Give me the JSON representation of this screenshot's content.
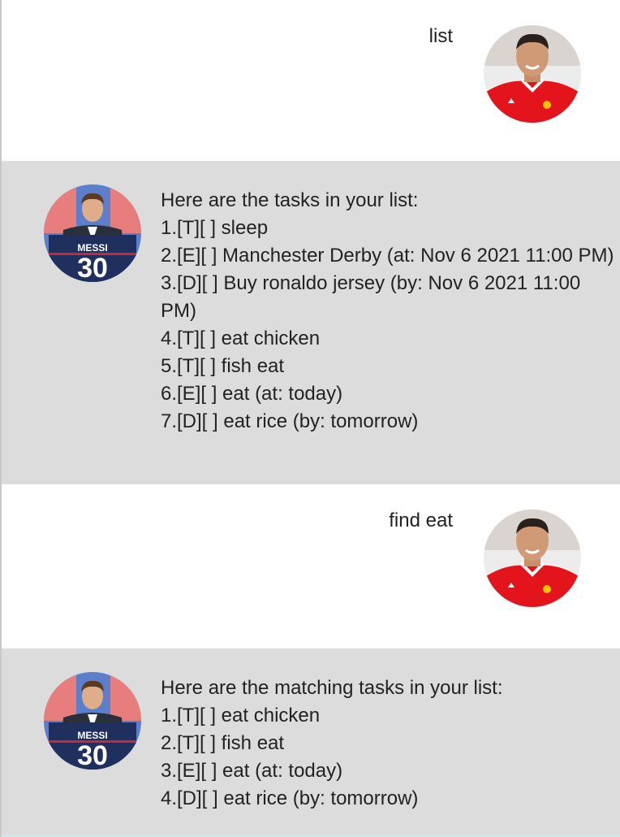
{
  "conversation": [
    {
      "role": "user",
      "text": "list"
    },
    {
      "role": "bot",
      "lines": [
        "Here are the tasks in your list:",
        "1.[T][ ] sleep",
        "2.[E][ ] Manchester Derby (at: Nov 6 2021 11:00 PM)",
        "3.[D][ ] Buy ronaldo jersey (by: Nov 6 2021 11:00 PM)",
        "4.[T][ ] eat chicken",
        "5.[T][ ] fish eat",
        "6.[E][ ] eat (at: today)",
        "7.[D][ ] eat rice (by: tomorrow)"
      ]
    },
    {
      "role": "user",
      "text": "find eat"
    },
    {
      "role": "bot",
      "lines": [
        "Here are the matching tasks in your list:",
        "1.[T][ ] eat chicken",
        "2.[T][ ] fish eat",
        "3.[E][ ] eat (at: today)",
        "4.[D][ ] eat rice (by: tomorrow)"
      ]
    }
  ],
  "avatar_jersey": {
    "name": "MESSI",
    "number": "30"
  },
  "colors": {
    "bot_bg": "#dcdcdc",
    "user_bg": "#ffffff",
    "user_shirt": "#e3141c",
    "bot_shirt": "#1f2f5e"
  }
}
